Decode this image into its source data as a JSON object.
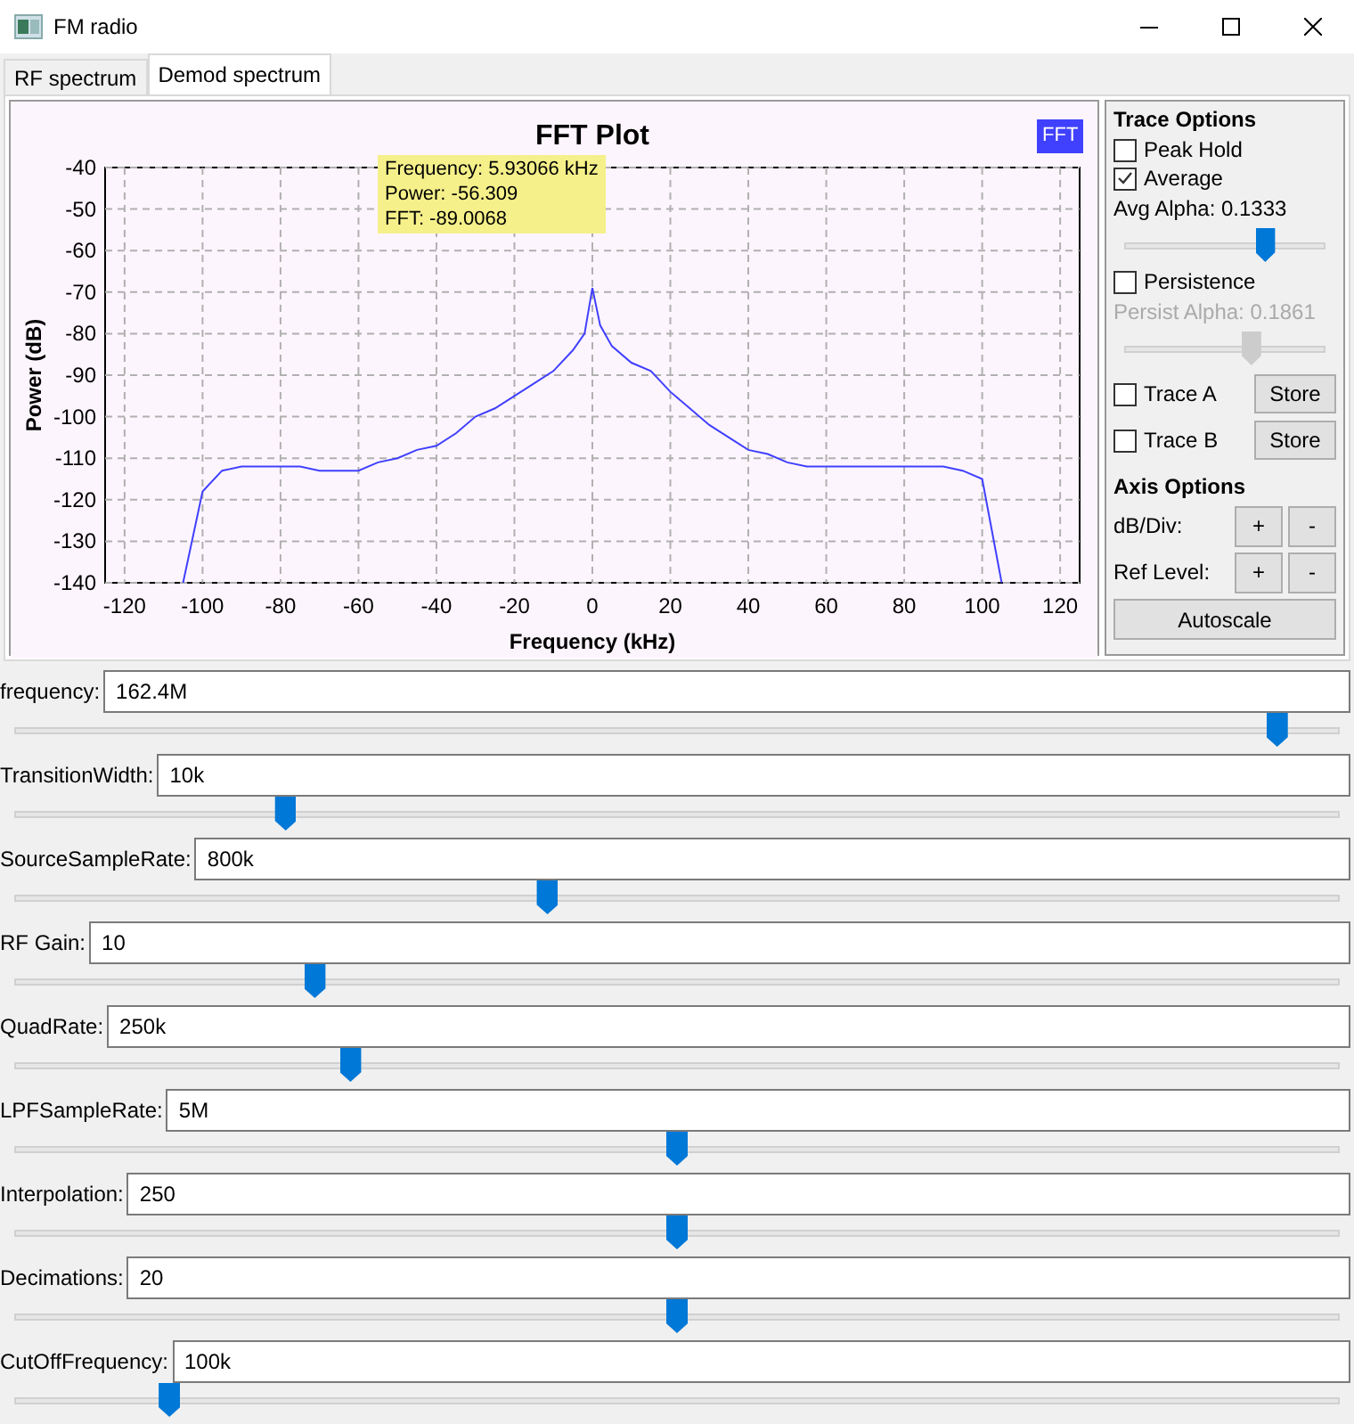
{
  "window": {
    "title": "FM radio"
  },
  "tabs": [
    {
      "label": "RF spectrum",
      "selected": false
    },
    {
      "label": "Demod spectrum",
      "selected": true
    }
  ],
  "plot": {
    "tooltip": [
      "Frequency: 5.93066 kHz",
      "Power: -56.309",
      "FFT: -89.0068"
    ],
    "chart_data": {
      "type": "line",
      "title": "FFT Plot",
      "xlabel": "Frequency (kHz)",
      "ylabel": "Power (dB)",
      "x": [
        -105,
        -100,
        -95,
        -90,
        -85,
        -80,
        -75,
        -70,
        -65,
        -60,
        -55,
        -50,
        -45,
        -40,
        -35,
        -30,
        -25,
        -20,
        -15,
        -10,
        -5,
        -2,
        0,
        2,
        5,
        10,
        15,
        20,
        25,
        30,
        35,
        40,
        45,
        50,
        55,
        60,
        65,
        70,
        75,
        80,
        85,
        90,
        95,
        100,
        105
      ],
      "series": [
        {
          "name": "FFT",
          "color": "#4040ff",
          "values": [
            -140,
            -118,
            -113,
            -112,
            -112,
            -112,
            -112,
            -113,
            -113,
            -113,
            -111,
            -110,
            -108,
            -107,
            -104,
            -100,
            -98,
            -95,
            -92,
            -89,
            -84,
            -80,
            -69,
            -78,
            -83,
            -87,
            -89,
            -94,
            -98,
            -102,
            -105,
            -108,
            -109,
            -111,
            -112,
            -112,
            -112,
            -112,
            -112,
            -112,
            -112,
            -112,
            -113,
            -115,
            -140
          ]
        }
      ],
      "grid": true,
      "xlim": [
        -125,
        125
      ],
      "ylim": [
        -140,
        -40
      ],
      "xticks": [
        -120,
        -100,
        -80,
        -60,
        -40,
        -20,
        0,
        20,
        40,
        60,
        80,
        100,
        120
      ],
      "yticks": [
        -140,
        -130,
        -120,
        -110,
        -100,
        -90,
        -80,
        -70,
        -60,
        -50,
        -40
      ]
    }
  },
  "trace_options": {
    "title": "Trace Options",
    "peak_hold": {
      "label": "Peak Hold",
      "checked": false
    },
    "average": {
      "label": "Average",
      "checked": true
    },
    "avg_alpha": {
      "label": "Avg Alpha: 0.1333",
      "level": 0.7,
      "disabled": false
    },
    "persistence": {
      "label": "Persistence",
      "checked": false
    },
    "persist_alpha": {
      "label": "Persist Alpha: 0.1861",
      "level": 0.63,
      "disabled": true
    },
    "traces": [
      {
        "label": "Trace A",
        "checked": false,
        "button": "Store"
      },
      {
        "label": "Trace B",
        "checked": false,
        "button": "Store"
      }
    ]
  },
  "axis_options": {
    "title": "Axis Options",
    "rows": [
      {
        "label": "dB/Div:",
        "plus": "+",
        "minus": "-"
      },
      {
        "label": "Ref Level:",
        "plus": "+",
        "minus": "-"
      }
    ],
    "autoscale": "Autoscale"
  },
  "params": [
    {
      "label": "frequency:",
      "value": "162.4M",
      "level": 0.954
    },
    {
      "label": "TransitionWidth:",
      "value": "10k",
      "level": 0.204
    },
    {
      "label": "SourceSampleRate:",
      "value": "800k",
      "level": 0.402
    },
    {
      "label": "RF Gain:",
      "value": "10",
      "level": 0.226
    },
    {
      "label": "QuadRate:",
      "value": "250k",
      "level": 0.253
    },
    {
      "label": "LPFSampleRate:",
      "value": "5M",
      "level": 0.5
    },
    {
      "label": "Interpolation:",
      "value": "250",
      "level": 0.5
    },
    {
      "label": "Decimations:",
      "value": "20",
      "level": 0.5
    },
    {
      "label": "CutOffFrequency:",
      "value": "100k",
      "level": 0.116
    }
  ]
}
